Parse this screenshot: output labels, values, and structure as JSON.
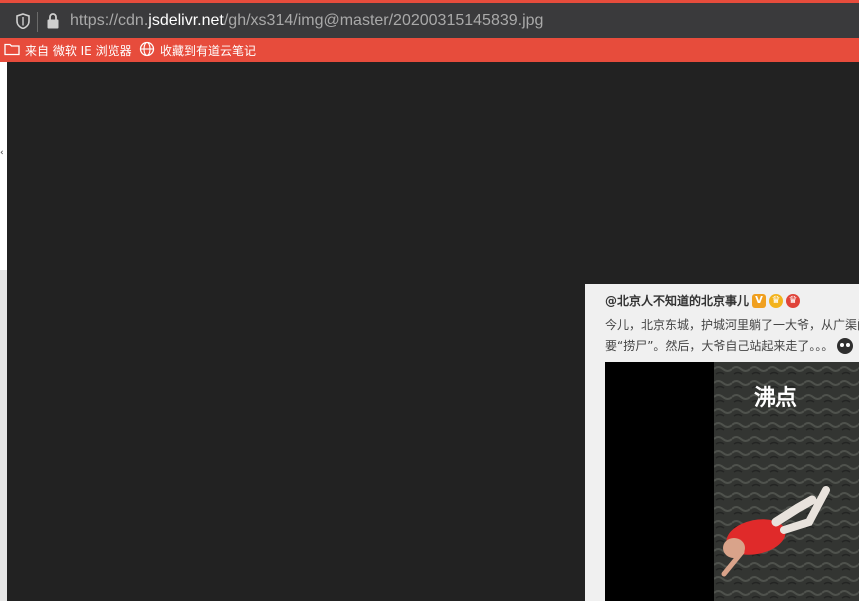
{
  "browser": {
    "url_prefix": "https://cdn.",
    "url_domain": "jsdelivr.net",
    "url_path": "/gh/xs314/img@master/20200315145839.jpg",
    "bookmarks": [
      {
        "label": "来自 微软 IE 浏览器",
        "icon": "folder-icon"
      },
      {
        "label": "收藏到有道云笔记",
        "icon": "globe-icon"
      }
    ],
    "accent": "#e74c3c"
  },
  "post": {
    "author": "@北京人不知道的北京事儿",
    "line1": "今儿，北京东城，护城河里躺了一大爷，从广渠门",
    "line2": "要“捞尸”。然后，大爷自己站起来走了。。。",
    "video": {
      "watermark": "沸点"
    }
  }
}
